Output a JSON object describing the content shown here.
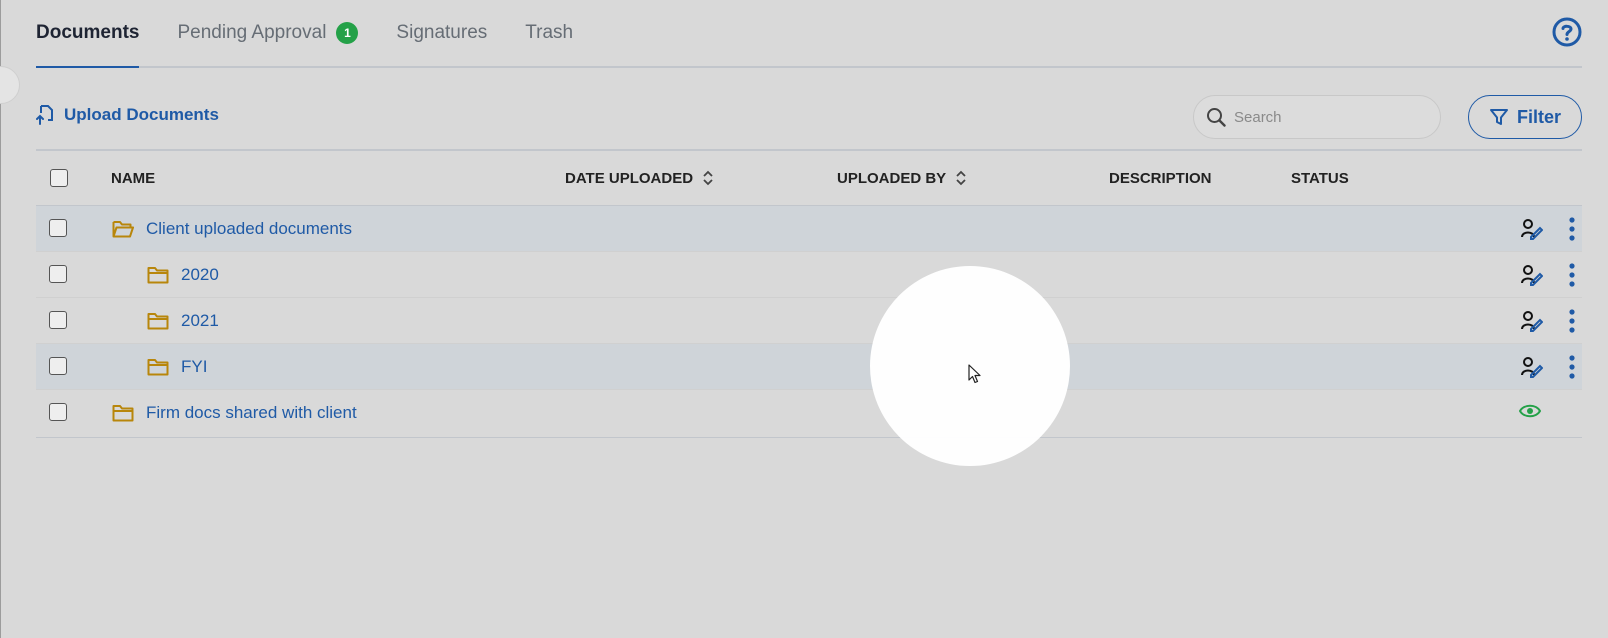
{
  "tabs": [
    {
      "label": "Documents",
      "active": true
    },
    {
      "label": "Pending Approval",
      "badge": "1"
    },
    {
      "label": "Signatures"
    },
    {
      "label": "Trash"
    }
  ],
  "toolbar": {
    "upload_label": "Upload Documents",
    "search_placeholder": "Search",
    "filter_label": "Filter"
  },
  "table": {
    "columns": {
      "name": "NAME",
      "date_uploaded": "DATE UPLOADED",
      "uploaded_by": "UPLOADED BY",
      "description": "DESCRIPTION",
      "status": "STATUS"
    },
    "rows": [
      {
        "name": "Client uploaded documents",
        "level": 0,
        "icon": "folder-open-icon",
        "action": "client-permission-icon"
      },
      {
        "name": "2020",
        "level": 1,
        "icon": "folder-icon",
        "action": "client-permission-icon"
      },
      {
        "name": "2021",
        "level": 1,
        "icon": "folder-icon",
        "action": "client-permission-icon"
      },
      {
        "name": "FYI",
        "level": 1,
        "icon": "folder-icon",
        "action": "client-permission-icon"
      },
      {
        "name": "Firm docs shared with client",
        "level": 0,
        "icon": "folder-icon",
        "action": "eye-icon"
      }
    ]
  },
  "colors": {
    "accent": "#1f5aa6",
    "badge": "#24a148",
    "folder": "#b8860b",
    "eye": "#24a148"
  }
}
